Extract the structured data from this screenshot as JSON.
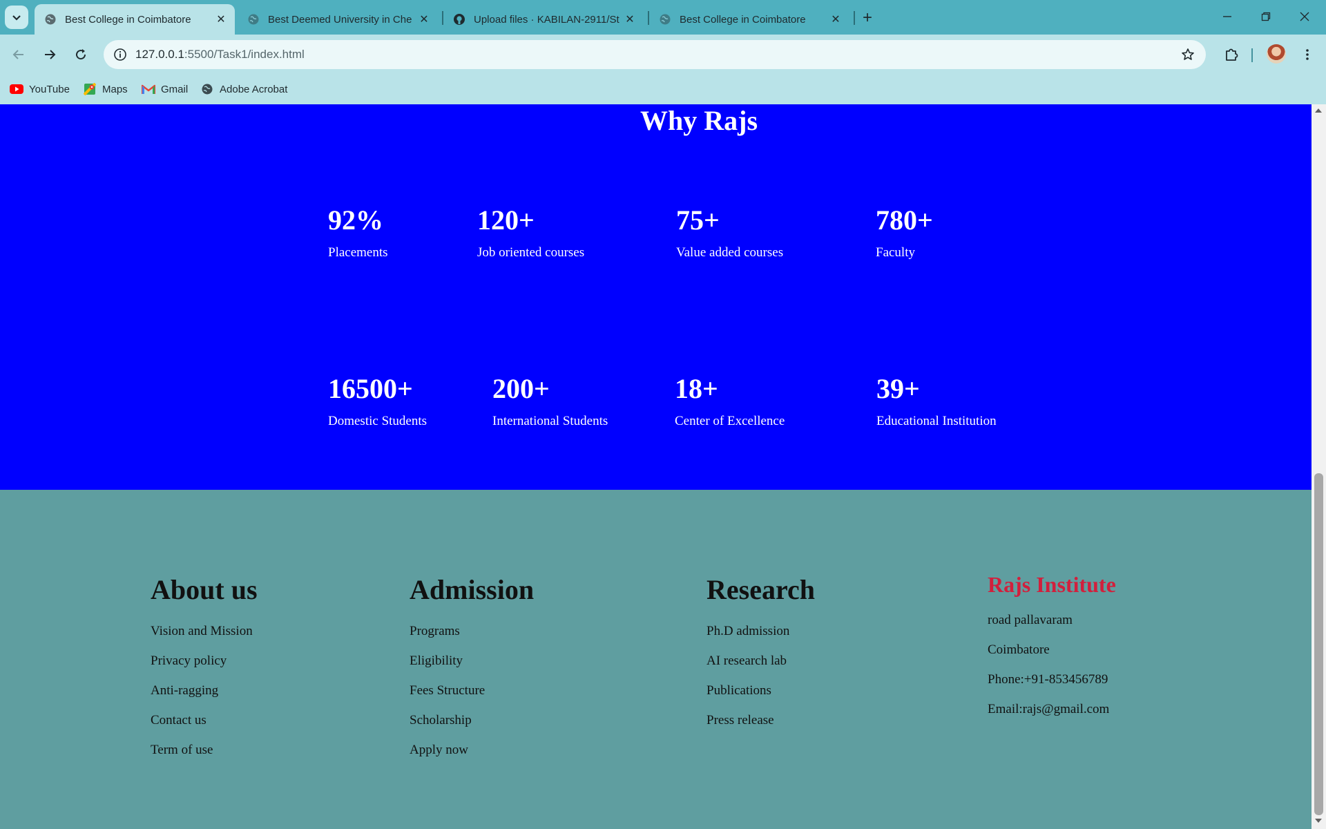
{
  "browser": {
    "tabs": [
      {
        "title": "Best College in Coimbatore",
        "active": true,
        "favicon": "globe-icon"
      },
      {
        "title": "Best Deemed University in Che",
        "active": false,
        "favicon": "globe-icon"
      },
      {
        "title": "Upload files · KABILAN-2911/St",
        "active": false,
        "favicon": "github-icon"
      },
      {
        "title": "Best College in Coimbatore",
        "active": false,
        "favicon": "globe-icon"
      }
    ],
    "close_glyph": "✕",
    "new_tab_glyph": "+",
    "url_host": "127.0.0.1",
    "url_path": ":5500/Task1/index.html",
    "bookmarks": [
      {
        "label": "YouTube",
        "icon": "youtube-icon"
      },
      {
        "label": "Maps",
        "icon": "maps-icon"
      },
      {
        "label": "Gmail",
        "icon": "gmail-icon"
      },
      {
        "label": "Adobe Acrobat",
        "icon": "globe-icon"
      }
    ]
  },
  "why": {
    "title": "Why Rajs",
    "stats": [
      {
        "value": "92%",
        "label": "Placements"
      },
      {
        "value": "120+",
        "label": "Job oriented courses"
      },
      {
        "value": "75+",
        "label": "Value added courses"
      },
      {
        "value": "780+",
        "label": "Faculty"
      },
      {
        "value": "16500+",
        "label": "Domestic Students"
      },
      {
        "value": "200+",
        "label": "International Students"
      },
      {
        "value": "18+",
        "label": "Center of Excellence"
      },
      {
        "value": "39+",
        "label": "Educational Institution"
      }
    ]
  },
  "footer": {
    "about": {
      "heading": "About us",
      "links": [
        "Vision and Mission",
        "Privacy policy",
        "Anti-ragging",
        "Contact us",
        "Term of use"
      ]
    },
    "admission": {
      "heading": "Admission",
      "links": [
        "Programs",
        "Eligibility",
        "Fees Structure",
        "Scholarship",
        "Apply now"
      ]
    },
    "research": {
      "heading": "Research",
      "links": [
        "Ph.D admission",
        "AI research lab",
        "Publications",
        "Press release"
      ]
    },
    "brand": {
      "name": "Rajs Institute",
      "lines": [
        "road pallavaram",
        "Coimbatore",
        "Phone:+91-853456789",
        "Email:rajs@gmail.com"
      ]
    }
  },
  "colors": {
    "tabbar": "#4fb0bf",
    "toolbar": "#b9e3e8",
    "why_bg": "#0000ff",
    "footer_bg": "#5f9ea0",
    "brand": "#d21f3c"
  }
}
